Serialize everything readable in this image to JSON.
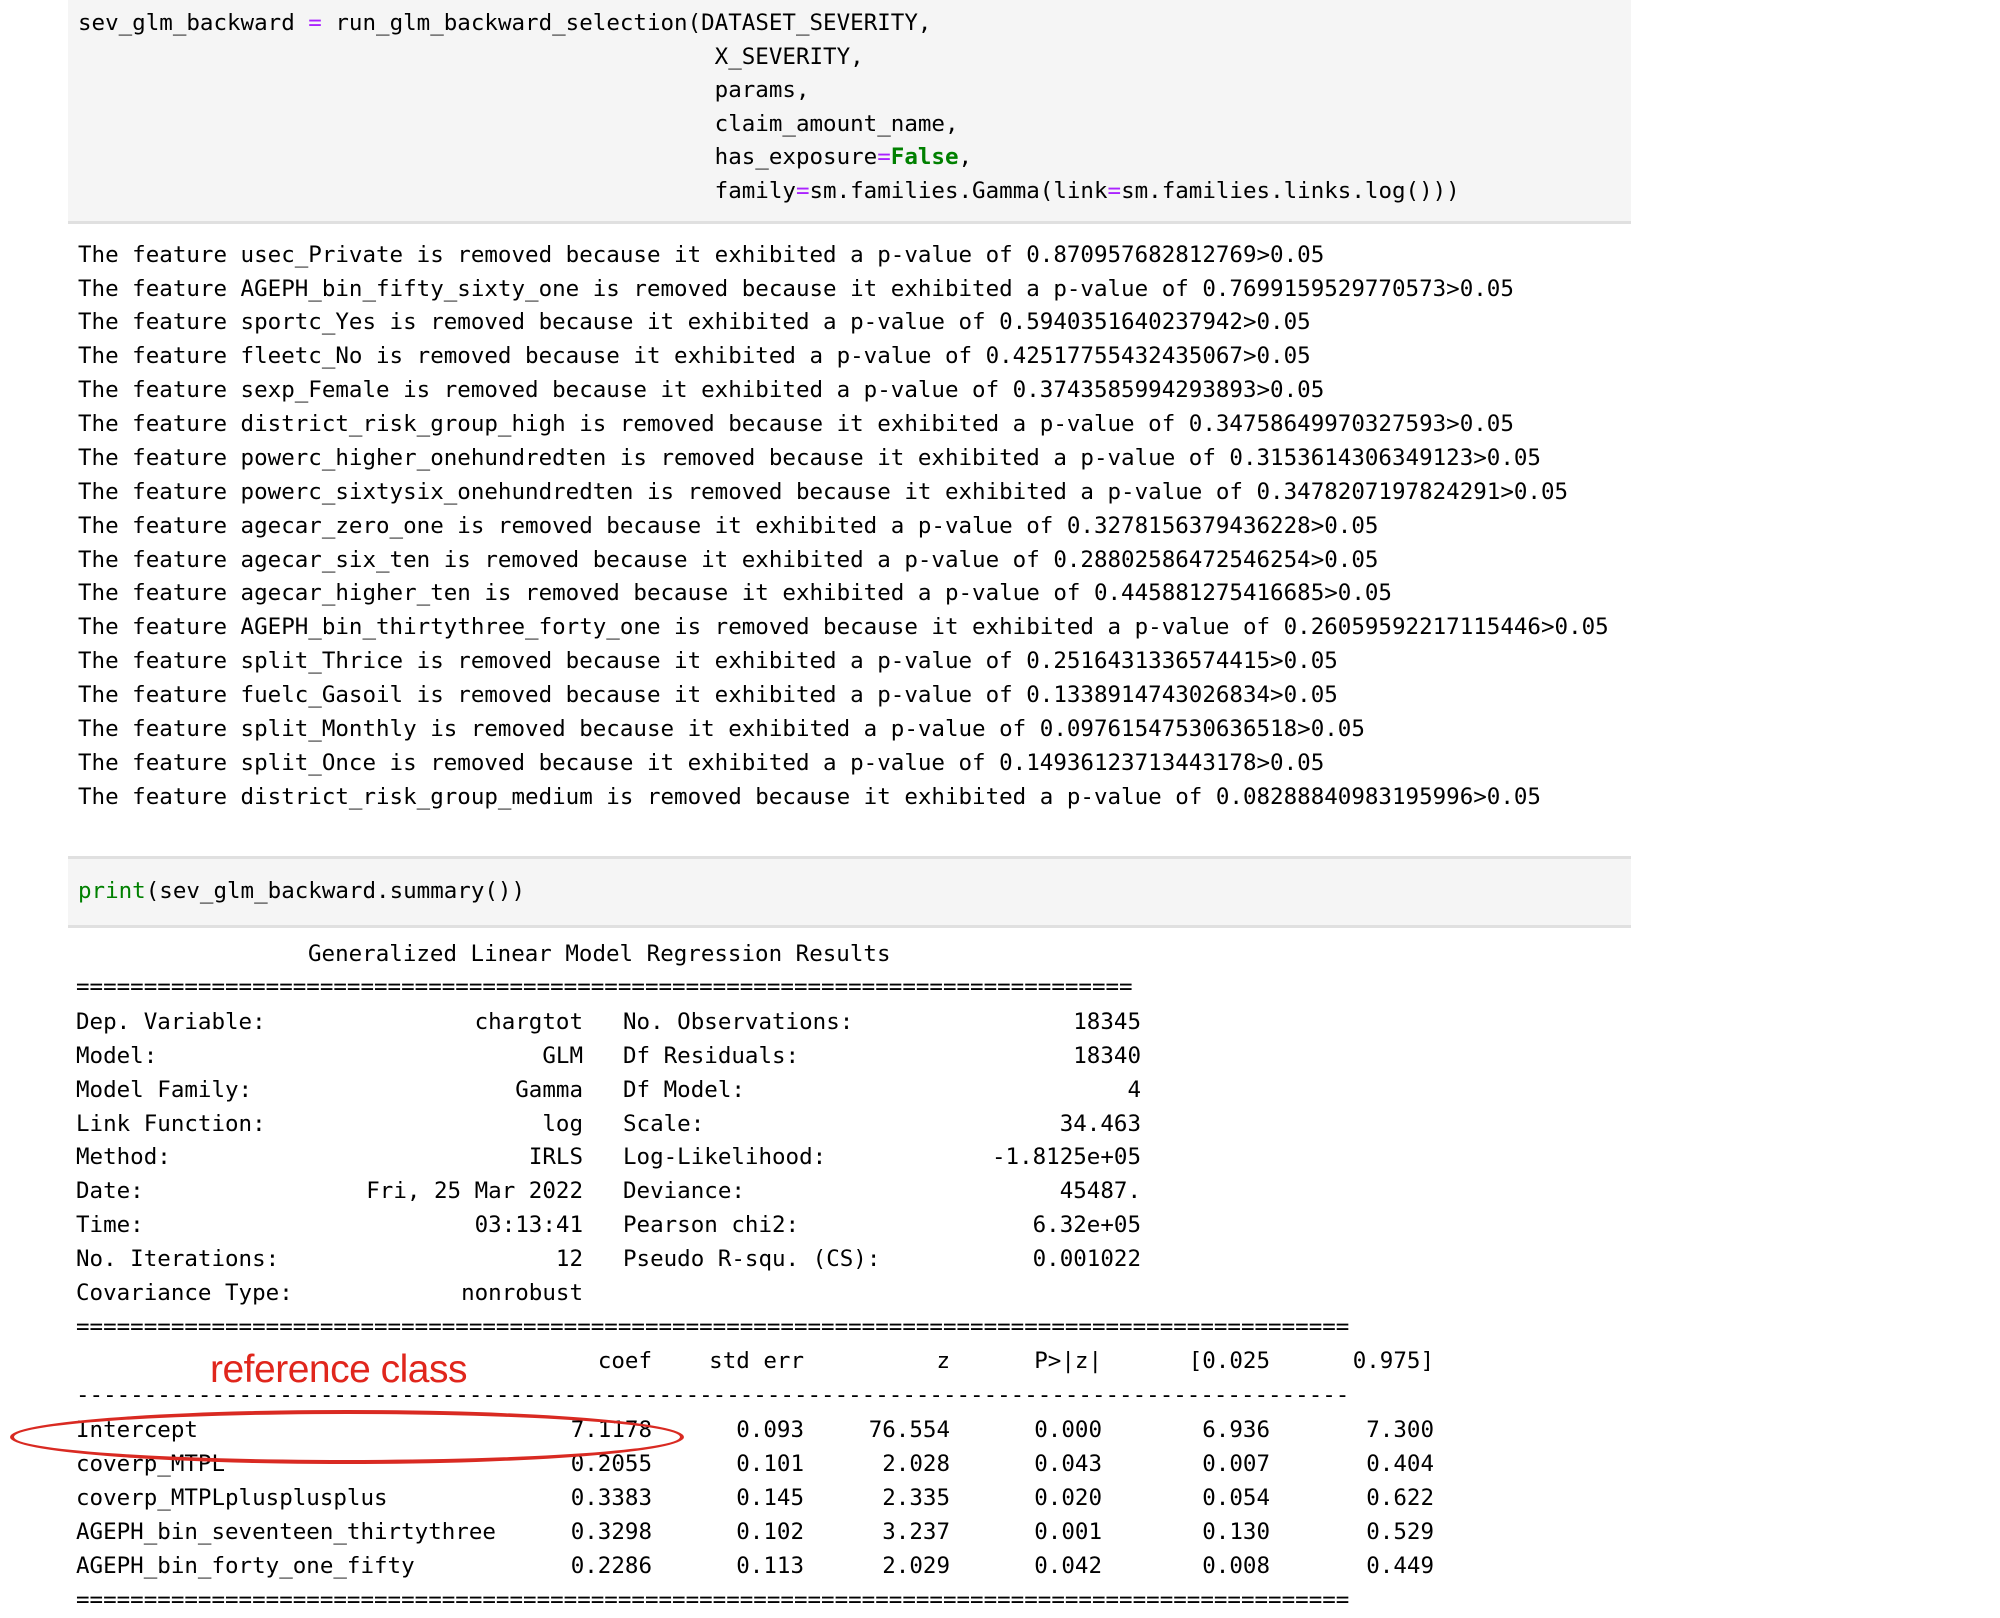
{
  "code_cell_1": {
    "lines": [
      {
        "prefix": "sev_glm_backward ",
        "eq": "=",
        "rest": " run_glm_backward_selection(DATASET_SEVERITY,"
      },
      {
        "text": "                                               X_SEVERITY,"
      },
      {
        "text": "                                               params,"
      },
      {
        "text": "                                               claim_amount_name,"
      },
      {
        "prefix": "                                               has_exposure",
        "eq": "=",
        "kw": "False",
        "rest": ","
      },
      {
        "prefix": "                                               family",
        "eq": "=",
        "mid": "sm.families.Gamma(link",
        "eq2": "=",
        "rest": "sm.families.links.log()))"
      }
    ]
  },
  "output_1": {
    "lines": [
      "The feature usec_Private is removed because it exhibited a p-value of 0.870957682812769>0.05",
      "The feature AGEPH_bin_fifty_sixty_one is removed because it exhibited a p-value of 0.7699159529770573>0.05",
      "The feature sportc_Yes is removed because it exhibited a p-value of 0.5940351640237942>0.05",
      "The feature fleetc_No is removed because it exhibited a p-value of 0.42517755432435067>0.05",
      "The feature sexp_Female is removed because it exhibited a p-value of 0.3743585994293893>0.05",
      "The feature district_risk_group_high is removed because it exhibited a p-value of 0.34758649970327593>0.05",
      "The feature powerc_higher_onehundredten is removed because it exhibited a p-value of 0.3153614306349123>0.05",
      "The feature powerc_sixtysix_onehundredten is removed because it exhibited a p-value of 0.3478207197824291>0.05",
      "The feature agecar_zero_one is removed because it exhibited a p-value of 0.3278156379436228>0.05",
      "The feature agecar_six_ten is removed because it exhibited a p-value of 0.28802586472546254>0.05",
      "The feature agecar_higher_ten is removed because it exhibited a p-value of 0.445881275416685>0.05",
      "The feature AGEPH_bin_thirtythree_forty_one is removed because it exhibited a p-value of 0.26059592217115446>0.05",
      "The feature split_Thrice is removed because it exhibited a p-value of 0.2516431336574415>0.05",
      "The feature fuelc_Gasoil is removed because it exhibited a p-value of 0.1338914743026834>0.05",
      "The feature split_Monthly is removed because it exhibited a p-value of 0.09761547530636518>0.05",
      "The feature split_Once is removed because it exhibited a p-value of 0.14936123713443178>0.05",
      "The feature district_risk_group_medium is removed because it exhibited a p-value of 0.08288840983195996>0.05"
    ]
  },
  "code_cell_2": {
    "builtin": "print",
    "rest": "(sev_glm_backward.summary())"
  },
  "summary": {
    "title": "Generalized Linear Model Regression Results",
    "rule_short": "==============================================================================",
    "rule_long": "==============================================================================================",
    "rule_dash": "----------------------------------------------------------------------------------------------",
    "left_rows": [
      {
        "label": "Dep. Variable:",
        "value": "chargtot"
      },
      {
        "label": "Model:",
        "value": "GLM"
      },
      {
        "label": "Model Family:",
        "value": "Gamma"
      },
      {
        "label": "Link Function:",
        "value": "log"
      },
      {
        "label": "Method:",
        "value": "IRLS"
      },
      {
        "label": "Date:",
        "value": "Fri, 25 Mar 2022"
      },
      {
        "label": "Time:",
        "value": "03:13:41"
      },
      {
        "label": "No. Iterations:",
        "value": "12"
      },
      {
        "label": "Covariance Type:",
        "value": "nonrobust"
      }
    ],
    "right_rows": [
      {
        "label": "No. Observations:",
        "value": "18345"
      },
      {
        "label": "Df Residuals:",
        "value": "18340"
      },
      {
        "label": "Df Model:",
        "value": "4"
      },
      {
        "label": "Scale:",
        "value": "34.463"
      },
      {
        "label": "Log-Likelihood:",
        "value": "-1.8125e+05"
      },
      {
        "label": "Deviance:",
        "value": "45487."
      },
      {
        "label": "Pearson chi2:",
        "value": "6.32e+05"
      },
      {
        "label": "Pseudo R-squ. (CS):",
        "value": "0.001022"
      }
    ],
    "coef_headers": [
      "coef",
      "std err",
      "z",
      "P>|z|",
      "[0.025",
      "0.975]"
    ],
    "coef_rows": [
      {
        "name": "Intercept",
        "values": [
          "7.1178",
          "0.093",
          "76.554",
          "0.000",
          "6.936",
          "7.300"
        ]
      },
      {
        "name": "coverp_MTPL",
        "values": [
          "0.2055",
          "0.101",
          "2.028",
          "0.043",
          "0.007",
          "0.404"
        ]
      },
      {
        "name": "coverp_MTPLplusplusplus",
        "values": [
          "0.3383",
          "0.145",
          "2.335",
          "0.020",
          "0.054",
          "0.622"
        ]
      },
      {
        "name": "AGEPH_bin_seventeen_thirtythree",
        "values": [
          "0.3298",
          "0.102",
          "3.237",
          "0.001",
          "0.130",
          "0.529"
        ]
      },
      {
        "name": "AGEPH_bin_forty_one_fifty",
        "values": [
          "0.2286",
          "0.113",
          "2.029",
          "0.042",
          "0.008",
          "0.449"
        ]
      }
    ]
  },
  "annotation": {
    "label": "reference class",
    "color": "#e0261c"
  }
}
